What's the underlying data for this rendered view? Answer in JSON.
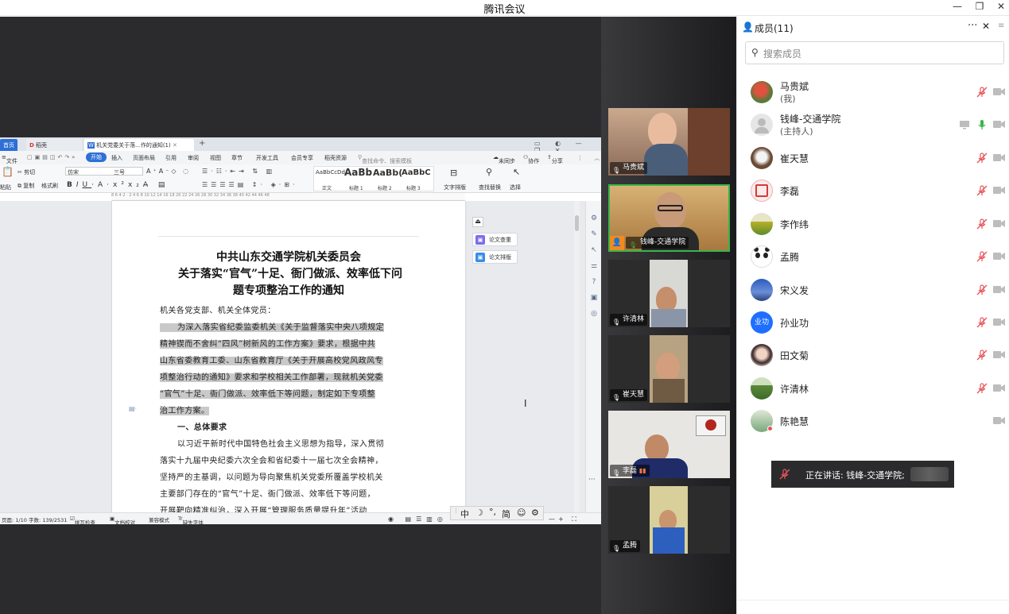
{
  "app": {
    "title": "腾讯会议",
    "window_controls": [
      "—",
      "❐",
      "✕"
    ]
  },
  "panel": {
    "title": "成员(11)",
    "more": "···",
    "close": "✕",
    "search_placeholder": "搜索成员",
    "members": [
      {
        "name": "马贵斌",
        "sub": "(我)",
        "mic": "muted",
        "avatar": "flower"
      },
      {
        "name": "钱峰-交通学院",
        "sub": "(主持人)",
        "mic": "active",
        "avatar": "default"
      },
      {
        "name": "崔天慧",
        "mic": "muted",
        "avatar": "dog"
      },
      {
        "name": "李磊",
        "mic": "muted",
        "avatar": "red-seal"
      },
      {
        "name": "李作纬",
        "mic": "muted",
        "avatar": "field"
      },
      {
        "name": "孟腾",
        "mic": "muted",
        "avatar": "panda"
      },
      {
        "name": "宋义发",
        "mic": "muted",
        "avatar": "sky"
      },
      {
        "name": "孙业功",
        "mic": "muted",
        "avatar": "text",
        "avatar_text": "业功"
      },
      {
        "name": "田文菊",
        "mic": "muted",
        "avatar": "girl"
      },
      {
        "name": "许清林",
        "mic": "muted",
        "avatar": "landscape"
      },
      {
        "name": "陈艳慧",
        "mic": "none",
        "avatar": "green"
      }
    ]
  },
  "speaking": {
    "label": "正在讲话: 钱峰-交通学院;"
  },
  "videos": [
    {
      "name": "马贵斌",
      "mic": "muted"
    },
    {
      "name": "钱峰-交通学院",
      "mic": "active",
      "host": true
    },
    {
      "name": "许清林",
      "mic": "muted"
    },
    {
      "name": "崔天慧",
      "mic": "muted"
    },
    {
      "name": "李磊",
      "mic": "muted"
    },
    {
      "name": "孟腾",
      "mic": "muted"
    }
  ],
  "doc": {
    "tabs": [
      "首页",
      "稻壳",
      "机关党委关于落...作的通知(1)"
    ],
    "tab_add": "+",
    "menu": [
      "文件",
      "开始",
      "插入",
      "页面布局",
      "引用",
      "审阅",
      "视图",
      "章节",
      "开发工具",
      "会员专享",
      "稻壳资源"
    ],
    "search_cmd": "查找命令、搜索模板",
    "right_menu": [
      "未同步",
      "协作",
      "分享"
    ],
    "toolbar": {
      "font": "仿宋",
      "size": "三号",
      "paste": "粘贴",
      "cut": "剪切",
      "copy": "复制",
      "format": "格式刷",
      "styles": [
        {
          "preview": "AaBbCcDd",
          "label": "正文"
        },
        {
          "preview": "AaBb",
          "label": "标题 1"
        },
        {
          "preview": "AaBb(",
          "label": "标题 2"
        },
        {
          "preview": "AaBbC",
          "label": "标题 3"
        }
      ],
      "text_layout": "文字排版",
      "find": "查找替换",
      "select": "选择"
    },
    "ruler": "8 6 4 2 · 2 4 6 8 10 12 14 16 18 20 22 24 26 28 30 32 34 36 38 40 42 44 46 48",
    "title_line1": "中共山东交通学院机关委员会",
    "title_line2": "关于落实“官气”十足、衙门做派、效率低下问",
    "title_line3": "题专项整治工作的通知",
    "salutation": "机关各党支部、机关全体党员：",
    "para1": [
      "为深入落实省纪委监委机关《关于监督落实中央八项规定",
      "精神锲而不舍纠“四风”树新风的工作方案》要求，根据中共",
      "山东省委教育工委、山东省教育厅《关于开展高校党风政风专",
      "项整治行动的通知》要求和学校相关工作部署，现就机关党委",
      "“官气”十足、衙门做派、效率低下等问题，制定如下专项整",
      "治工作方案。"
    ],
    "section1": "一、总体要求",
    "para2": [
      "以习近平新时代中国特色社会主义思想为指导，深入贯彻",
      "落实十九届中央纪委六次全会和省纪委十一届七次全会精神，",
      "坚持严的主基调，以问题为导向聚焦机关党委所覆盖学校机关",
      "主要部门存在的“官气”十足、衙门做派、效率低下等问题，",
      "开展靶向精准纠治，深入开展“管理服务质量提升年”活动"
    ],
    "side": [
      "论文查重",
      "论文排版"
    ],
    "status": {
      "page": "页面: 1/10",
      "words": "字数: 139/2531",
      "spell": "拼写检查",
      "proof": "文档校对",
      "compat": "兼容模式",
      "font_missing": "缺失字体"
    },
    "ime": [
      "中",
      "☽",
      "°,",
      "简",
      "☺",
      "⚙"
    ]
  },
  "colors": {
    "accent": "#1e6fff",
    "mic_green": "#3bb54a",
    "mic_muted": "#e5555b",
    "stage": "#2b2b2d"
  }
}
